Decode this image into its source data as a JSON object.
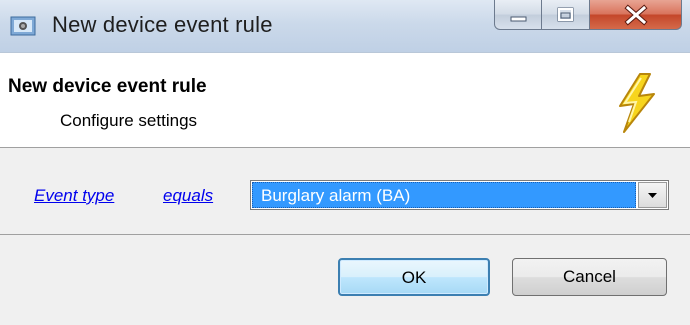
{
  "window": {
    "title": "New device event rule"
  },
  "header": {
    "title": "New device event rule",
    "subtitle": "Configure settings",
    "icon": "lightning-bolt-icon"
  },
  "rule": {
    "field_link": "Event type",
    "operator_link": "equals",
    "value_selected": "Burglary alarm (BA)"
  },
  "buttons": {
    "ok": "OK",
    "cancel": "Cancel"
  },
  "colors": {
    "selection": "#3399ff",
    "link": "#0000ee",
    "close_button": "#c4472a",
    "bolt_yellow": "#f7d51d"
  }
}
